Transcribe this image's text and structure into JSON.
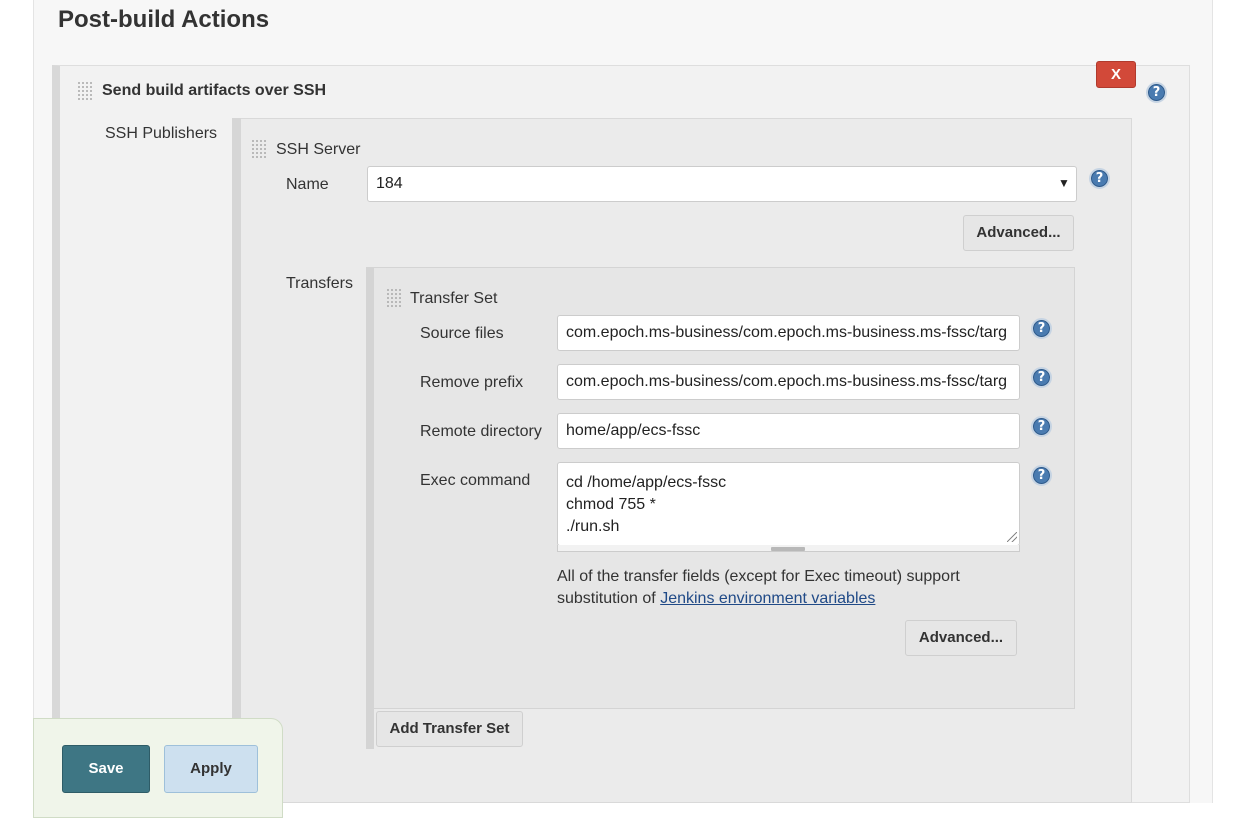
{
  "section": {
    "title": "Post-build Actions"
  },
  "builder": {
    "title": "Send build artifacts over SSH",
    "delete_label": "X",
    "help_glyph": "?",
    "publishers_label": "SSH Publishers"
  },
  "ssh_server": {
    "title": "SSH Server",
    "name_label": "Name",
    "name_value": "184",
    "select_arrow": "▼",
    "advanced_label": "Advanced...",
    "transfers_label": "Transfers"
  },
  "transfer_set": {
    "title": "Transfer Set",
    "source_files_label": "Source files",
    "source_files_value": "com.epoch.ms-business/com.epoch.ms-business.ms-fssc/targ",
    "remove_prefix_label": "Remove prefix",
    "remove_prefix_value": "com.epoch.ms-business/com.epoch.ms-business.ms-fssc/targ",
    "remote_directory_label": "Remote directory",
    "remote_directory_value": "home/app/ecs-fssc",
    "exec_command_label": "Exec command",
    "exec_command_lines": [
      "cd /home/app/ecs-fssc",
      "chmod 755 *",
      "./run.sh"
    ],
    "note_text": "All of the transfer fields (except for Exec timeout) support substitution of",
    "note_link": "Jenkins environment variables",
    "advanced_label": "Advanced...",
    "add_button_label": "Add Transfer Set"
  },
  "bottom_bar": {
    "save_label": "Save",
    "apply_label": "Apply"
  },
  "colors": {
    "delete": "#d24939",
    "save": "#3e7684",
    "apply": "#cde0ef",
    "help": "#4a7bb0",
    "link": "#204a87"
  },
  "icons": {
    "help": "help-icon",
    "drag": "drag-handle-icon",
    "dropdown": "chevron-down-icon"
  }
}
